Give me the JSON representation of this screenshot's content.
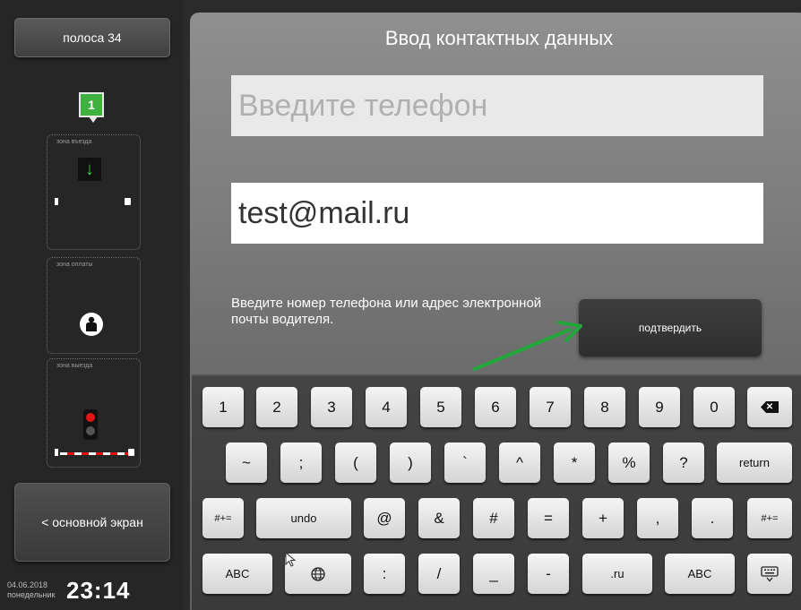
{
  "sidebar": {
    "lane_label": "полоса 34",
    "lane_number": "1",
    "zones": [
      "зона въезда",
      "зона оплаты",
      "зона выезда"
    ],
    "main_screen_label": "< основной экран",
    "date": "04.06.2018",
    "weekday": "понедельник",
    "time": "23:14"
  },
  "form": {
    "title": "Ввод контактных данных",
    "phone_placeholder": "Введите телефон",
    "phone_value": "",
    "email_value": "test@mail.ru",
    "hint": "Введите номер телефона или адрес электронной почты водителя.",
    "confirm_label": "подтвердить"
  },
  "keyboard": {
    "row1": [
      "1",
      "2",
      "3",
      "4",
      "5",
      "6",
      "7",
      "8",
      "9",
      "0"
    ],
    "row2": [
      "~",
      ";",
      "(",
      ")",
      "`",
      "^",
      "*",
      "%",
      "?"
    ],
    "return_label": "return",
    "row3_left": "#+=",
    "undo_label": "undo",
    "row3": [
      "@",
      "&",
      "#",
      "=",
      "+",
      ",",
      "."
    ],
    "row3_right": "#+=",
    "abc_left": "ABC",
    "row4": [
      ":",
      "/",
      "_",
      "-"
    ],
    "dot_ru": ".ru",
    "abc_right": "ABC"
  },
  "colors": {
    "accent_green": "#3fb13f",
    "arrow_green": "#22a83a",
    "panel_gray": "#7b7b7b"
  }
}
